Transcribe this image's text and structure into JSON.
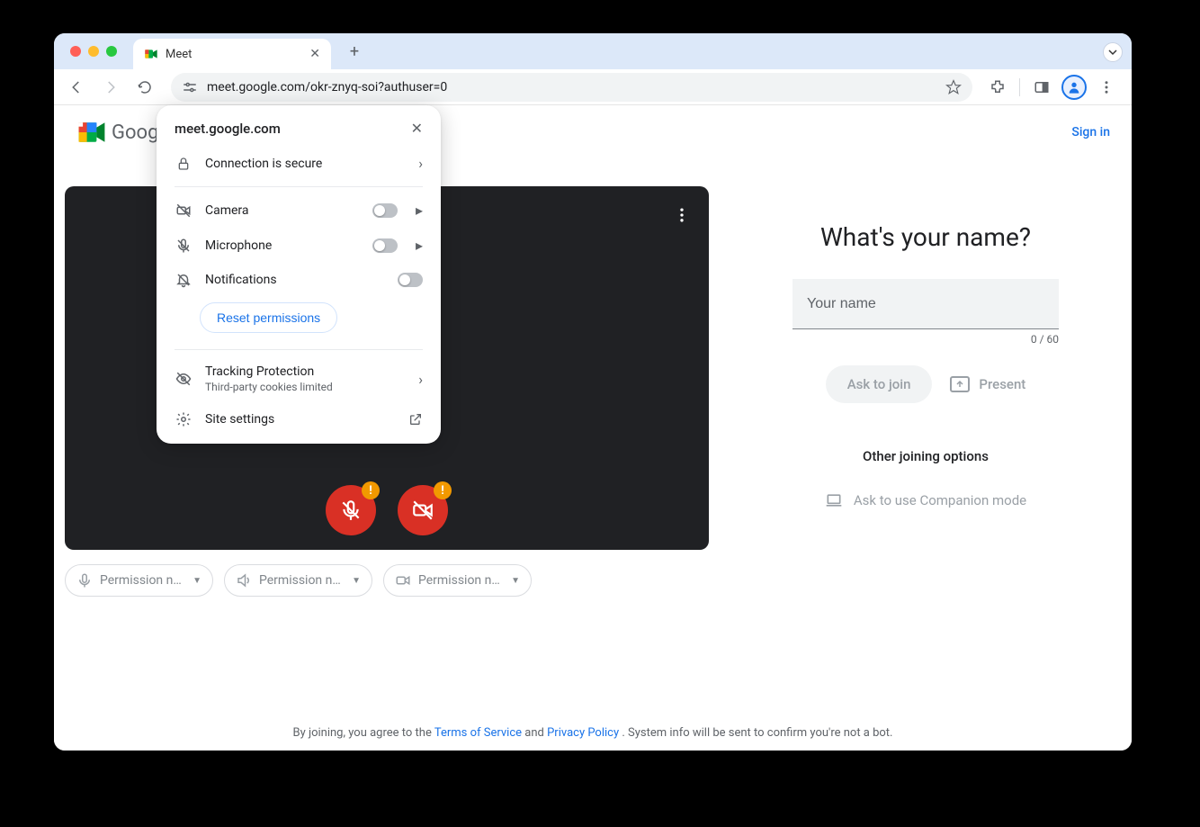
{
  "browser": {
    "tab_title": "Meet",
    "url": "meet.google.com/okr-znyq-soi?authuser=0"
  },
  "popover": {
    "site": "meet.google.com",
    "secure": "Connection is secure",
    "camera": "Camera",
    "microphone": "Microphone",
    "notifications": "Notifications",
    "reset": "Reset permissions",
    "tracking_title": "Tracking Protection",
    "tracking_sub": "Third-party cookies limited",
    "site_settings": "Site settings"
  },
  "header": {
    "logo_text": "Google Meet",
    "sign_in": "Sign in"
  },
  "chips": {
    "mic": "Permission ne…",
    "speaker": "Permission ne…",
    "camera": "Permission ne…"
  },
  "right": {
    "question": "What's your name?",
    "placeholder": "Your name",
    "char_count": "0 / 60",
    "ask_join": "Ask to join",
    "present": "Present",
    "other_options": "Other joining options",
    "companion": "Ask to use Companion mode"
  },
  "footer": {
    "pre": "By joining, you agree to the ",
    "tos": "Terms of Service",
    "and": " and ",
    "pp": "Privacy Policy",
    "post": ". System info will be sent to confirm you're not a bot."
  }
}
